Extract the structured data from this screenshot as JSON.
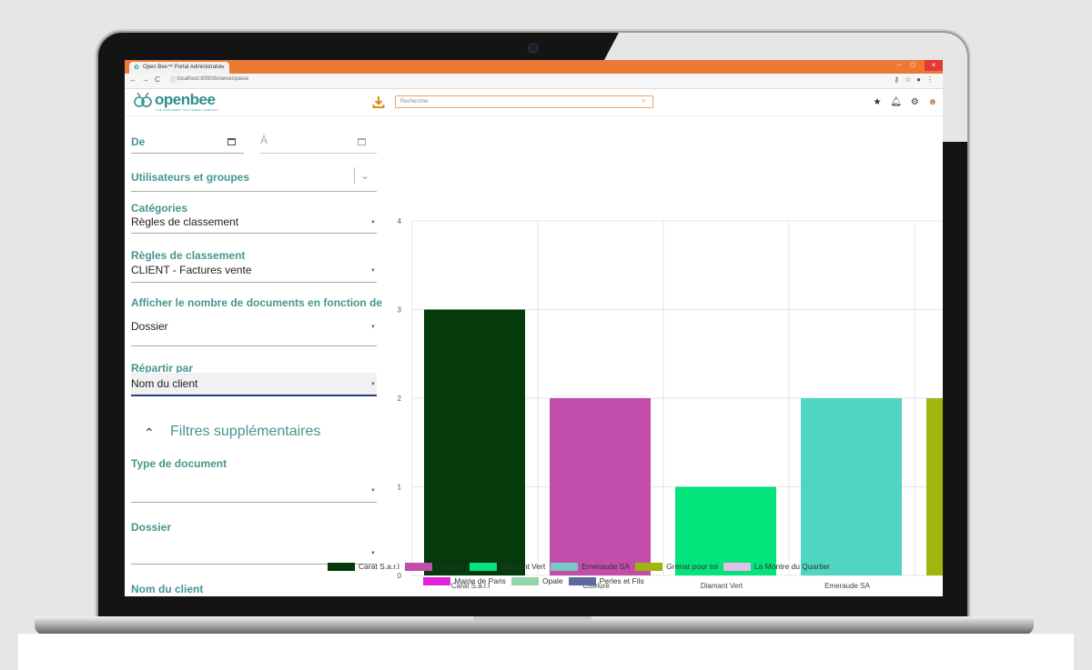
{
  "browser": {
    "tab_title": "Open Bee™ Portal Administrator",
    "tab_close": "×",
    "url": "localhost:8090/browse/queue",
    "win_controls": "– ◻",
    "win_close": "×"
  },
  "app": {
    "logo_text": "openbee",
    "logo_sub": "THE DOCUMENT SOFTWARE COMPANY",
    "search_placeholder": "Rechercher"
  },
  "filters": {
    "from_label": "De",
    "to_label": "À",
    "users_groups_label": "Utilisateurs et groupes",
    "categories_label": "Catégories",
    "categories_value": "Règles de classement",
    "rules_label": "Règles de classement",
    "rules_value": "CLIENT - Factures vente",
    "display_label": "Afficher le nombre de documents en fonction de",
    "display_value": "Dossier",
    "split_label": "Répartir par",
    "split_value": "Nom du client",
    "extra_filters_label": "Filtres supplémentaires",
    "doc_type_label": "Type de document",
    "folder_label": "Dossier",
    "client_name_label": "Nom du client"
  },
  "chart_data": {
    "type": "bar",
    "categories": [
      "Carat S.a.r.l",
      "Ciselure",
      "Diamant Vert",
      "Emeraude SA",
      "Grenat pour toi"
    ],
    "values": [
      3,
      2,
      1,
      2,
      2
    ],
    "colors": [
      "#053a0c",
      "#c24dab",
      "#04e47c",
      "#4fd5c0",
      "#9fb60c"
    ],
    "visible_tick_labels": [
      "Carat S.a.r.l",
      "Ciselure",
      "Diamant Vert",
      "Emeraude SA"
    ],
    "ylim": [
      0,
      4
    ],
    "y_ticks": [
      "0",
      "1",
      "2",
      "3",
      "4"
    ],
    "grid": true,
    "legend_placement": "bottom",
    "legend": [
      {
        "name": "Carat S.a.r.l",
        "color": "#053a0c"
      },
      {
        "name": "Ciselure",
        "color": "#c24dab"
      },
      {
        "name": "Diamant Vert",
        "color": "#04e47c"
      },
      {
        "name": "Emeraude SA",
        "color": "#76c9c4"
      },
      {
        "name": "Grenat pour toi",
        "color": "#9fb60c"
      },
      {
        "name": "La Montre du Quartier",
        "color": "#e4bde8"
      },
      {
        "name": "Mairie de Paris",
        "color": "#e025d8"
      },
      {
        "name": "Opale",
        "color": "#93d4a8"
      },
      {
        "name": "Perles et Fils",
        "color": "#5a6b9c"
      }
    ]
  }
}
